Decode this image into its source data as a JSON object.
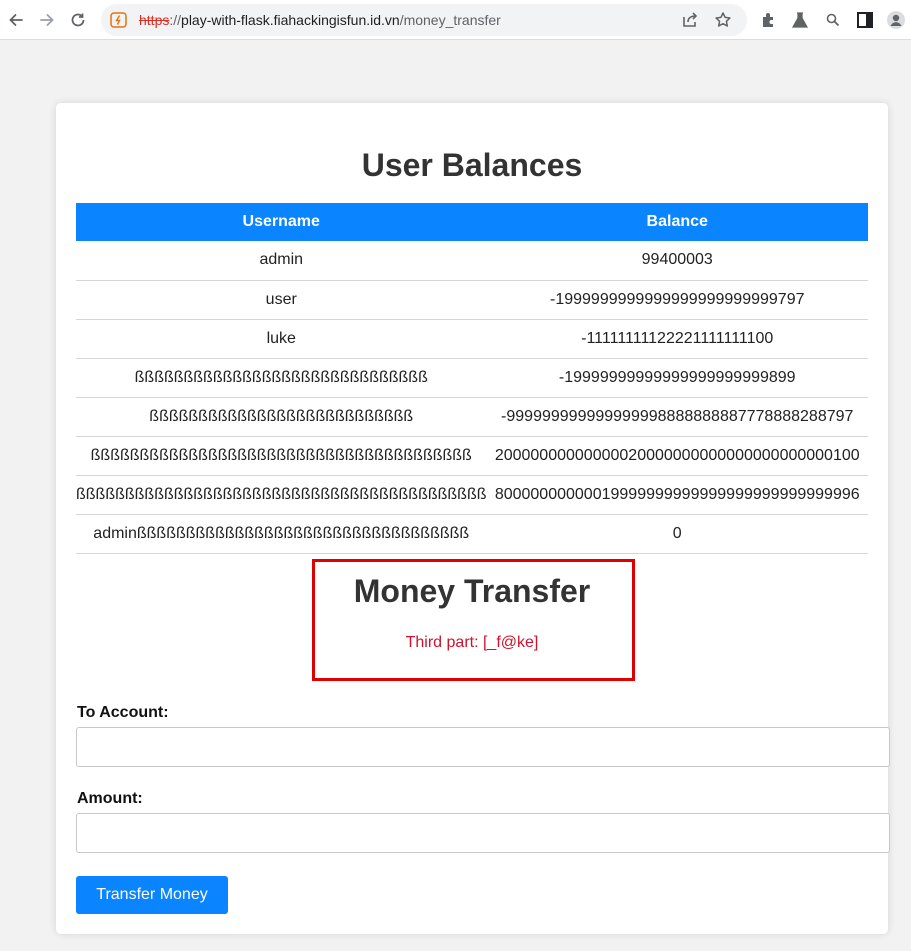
{
  "browser": {
    "url_scheme": "https",
    "url_sep": "://",
    "url_host": "play-with-flask.fiahackingisfun.id.vn",
    "url_path": "/money_transfer"
  },
  "page": {
    "title": "User Balances",
    "table": {
      "headers": [
        "Username",
        "Balance"
      ],
      "rows": [
        [
          "admin",
          "99400003"
        ],
        [
          "user",
          "-1999999999999999999999999797"
        ],
        [
          "luke",
          "-11111111122221111111100"
        ],
        [
          "ßßßßßßßßßßßßßßßßßßßßßßßßßßßßßß",
          "-19999999999999999999999899"
        ],
        [
          "ßßßßßßßßßßßßßßßßßßßßßßßßßßß",
          "-999999999999999998888888887778888288797"
        ],
        [
          "ßßßßßßßßßßßßßßßßßßßßßßßßßßßßßßßßßßßßßßß",
          "20000000000000020000000000000000000000100"
        ],
        [
          "ßßßßßßßßßßßßßßßßßßßßßßßßßßßßßßßßßßßßßßßßßß",
          "80000000000019999999999999999999999999996"
        ],
        [
          "adminßßßßßßßßßßßßßßßßßßßßßßßßßßßßßßßßßß",
          "0"
        ]
      ]
    },
    "transfer": {
      "title": "Money Transfer",
      "flag_text": "Third part: [_f@ke]",
      "to_account_label": "To Account:",
      "to_account_value": "",
      "amount_label": "Amount:",
      "amount_value": "",
      "submit_label": "Transfer Money"
    }
  },
  "colors": {
    "accent": "#0a84ff",
    "highlight_border": "#e00000",
    "flag_text": "#d0122c"
  },
  "icons": {
    "back": "arrow-left-icon",
    "forward": "arrow-right-icon",
    "reload": "reload-icon",
    "site_info": "not-secure-icon",
    "share": "share-icon",
    "bookmark": "star-icon",
    "extensions": "puzzle-icon",
    "labs": "flask-icon",
    "search": "search-icon",
    "side_panel": "side-panel-icon",
    "profile": "avatar-icon"
  }
}
